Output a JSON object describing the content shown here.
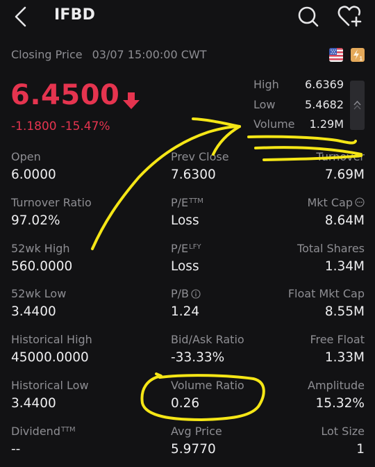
{
  "header": {
    "ticker": "IFBD",
    "back_icon": "chevron-left-icon",
    "search_icon": "search-icon",
    "watchlist_icon": "heart-plus-icon"
  },
  "status": {
    "label": "Closing Price",
    "timestamp": "03/07 15:00:00 CWT",
    "market_flag_icon": "us-flag-icon",
    "level_badge_icon": "lv1-lightning-icon"
  },
  "quote": {
    "price": "6.4500",
    "direction": "down",
    "change": "-1.1800",
    "change_pct": "-15.47%",
    "color_down": "#e5344f"
  },
  "summary": {
    "rows": [
      {
        "label": "High",
        "value": "6.6369"
      },
      {
        "label": "Low",
        "value": "5.4682"
      },
      {
        "label": "Volume",
        "value": "1.29M"
      }
    ],
    "collapse_icon": "double-chevron-up-icon"
  },
  "stats": {
    "rows": [
      [
        {
          "label": "Open",
          "value": "6.0000"
        },
        {
          "label": "Prev Close",
          "value": "7.6300"
        },
        {
          "label": "Turnover",
          "value": "7.69M"
        }
      ],
      [
        {
          "label": "Turnover Ratio",
          "value": "97.02%"
        },
        {
          "label": "P/E",
          "sup": "TTM",
          "value": "Loss"
        },
        {
          "label": "Mkt Cap",
          "value": "8.64M",
          "icon": "more-icon"
        }
      ],
      [
        {
          "label": "52wk High",
          "value": "560.0000"
        },
        {
          "label": "P/E",
          "sup": "LFY",
          "value": "Loss"
        },
        {
          "label": "Total Shares",
          "value": "1.34M"
        }
      ],
      [
        {
          "label": "52wk Low",
          "value": "3.4400"
        },
        {
          "label": "P/B",
          "value": "1.24",
          "icon": "info-icon"
        },
        {
          "label": "Float Mkt Cap",
          "value": "8.55M"
        }
      ],
      [
        {
          "label": "Historical High",
          "value": "45000.0000"
        },
        {
          "label": "Bid/Ask Ratio",
          "value": "-33.33%"
        },
        {
          "label": "Free Float",
          "value": "1.33M"
        }
      ],
      [
        {
          "label": "Historical Low",
          "value": "3.4400"
        },
        {
          "label": "Volume Ratio",
          "value": "0.26"
        },
        {
          "label": "Amplitude",
          "value": "15.32%"
        }
      ],
      [
        {
          "label": "Dividend",
          "sup": "TTM",
          "value": "--"
        },
        {
          "label": "Avg Price",
          "value": "5.9770"
        },
        {
          "label": "Lot Size",
          "value": "1"
        }
      ]
    ]
  },
  "annotations": {
    "color": "#f5e616",
    "items": [
      "arrow-to-volume",
      "underline-volume",
      "circle-volume-ratio"
    ]
  }
}
